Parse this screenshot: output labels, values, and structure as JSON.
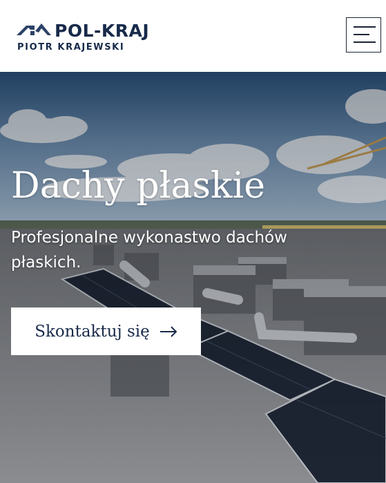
{
  "brand": {
    "name": "POL-KRAJ",
    "tagline": "PIOTR KRAJEWSKI",
    "colors": {
      "navy": "#182a4a",
      "roof_icon": "#2c4268"
    }
  },
  "header": {
    "menu_icon": "hamburger-menu-icon"
  },
  "hero": {
    "title": "Dachy płaskie",
    "subtitle": "Profesjonalne wykonastwo dachów płaskich.",
    "cta_label": "Skontaktuj się",
    "cta_icon": "arrow-right-icon"
  }
}
